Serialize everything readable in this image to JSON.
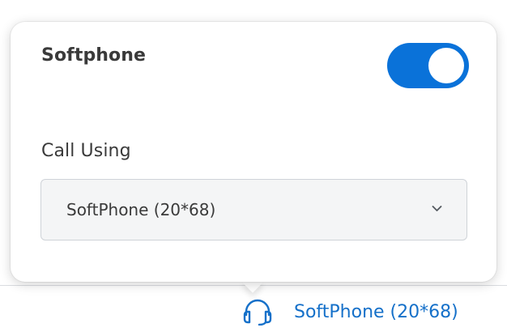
{
  "popover": {
    "softphone_label": "Softphone",
    "softphone_enabled": true,
    "call_using_label": "Call Using",
    "call_using_selected": "SoftPhone (20*68)"
  },
  "footer": {
    "device_label": "SoftPhone (20*68)",
    "device_icon": "headset-icon"
  },
  "colors": {
    "accent": "#0a72d9",
    "link": "#1570c9",
    "text": "#3a3a3a"
  }
}
